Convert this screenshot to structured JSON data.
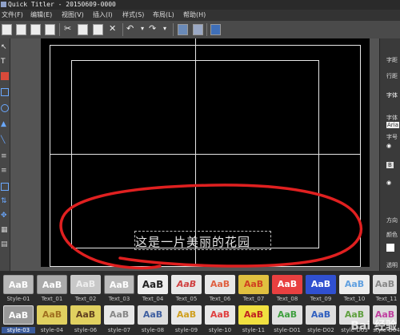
{
  "window": {
    "title": "Quick Titler - 20150609-0000"
  },
  "menu": [
    "文件(F)",
    "编辑(E)",
    "视图(V)",
    "插入(I)",
    "样式(S)",
    "布局(L)",
    "帮助(H)"
  ],
  "canvas": {
    "title_text": "这是一片美丽的花园"
  },
  "right_panel": {
    "labels": [
      "字距",
      "行距",
      "字体",
      "Aria",
      "字号",
      "B",
      "方向",
      "颜色",
      "透明"
    ]
  },
  "styles": {
    "row1": [
      {
        "swatch": "AaB",
        "label": "Style-01"
      },
      {
        "swatch": "AaB",
        "label": "Text_01"
      },
      {
        "swatch": "AaB",
        "label": "Text_02"
      },
      {
        "swatch": "AaB",
        "label": "Text_03"
      },
      {
        "swatch": "AaB",
        "label": "Text_04"
      },
      {
        "swatch": "AaB",
        "label": "Text_05"
      },
      {
        "swatch": "AaB",
        "label": "Text_06"
      },
      {
        "swatch": "AaB",
        "label": "Text_07"
      },
      {
        "swatch": "AaB",
        "label": "Text_08"
      },
      {
        "swatch": "AaB",
        "label": "Text_09"
      },
      {
        "swatch": "AaB",
        "label": "Text_10"
      },
      {
        "swatch": "AaB",
        "label": "Text_11"
      }
    ],
    "row2": [
      {
        "swatch": "AaB",
        "label": "style-03"
      },
      {
        "swatch": "AaB",
        "label": "style-04"
      },
      {
        "swatch": "AaB",
        "label": "style-06"
      },
      {
        "swatch": "AaB",
        "label": "style-07"
      },
      {
        "swatch": "AaB",
        "label": "style-08"
      },
      {
        "swatch": "AaB",
        "label": "style-09"
      },
      {
        "swatch": "AaB",
        "label": "style-10"
      },
      {
        "swatch": "AaB",
        "label": "style-11"
      },
      {
        "swatch": "AaB",
        "label": "style-D01"
      },
      {
        "swatch": "AaB",
        "label": "style-D02"
      },
      {
        "swatch": "AaB",
        "label": "style-D03"
      },
      {
        "swatch": "AaB",
        "label": "style-D04"
      }
    ]
  },
  "watermark": "Bai 经验",
  "colors": {
    "annotation": "#e02020",
    "canvas": "#000000",
    "guides": "#e6e6e6"
  },
  "icons": [
    "new-file-icon",
    "open-icon",
    "save-icon",
    "save-all-icon",
    "cut-icon",
    "copy-icon",
    "paste-icon",
    "delete-icon",
    "undo-icon",
    "redo-icon",
    "text-style-icon",
    "text-effect-icon",
    "help-icon"
  ]
}
